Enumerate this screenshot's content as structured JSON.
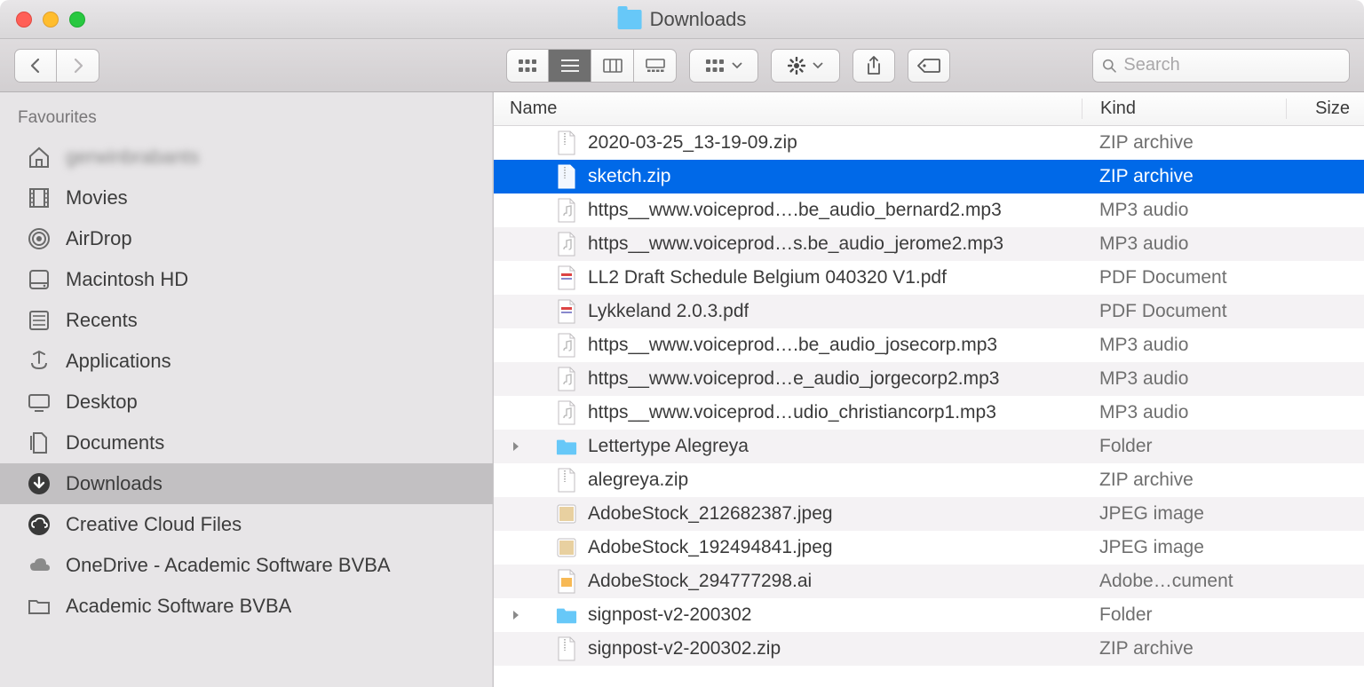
{
  "window": {
    "title": "Downloads"
  },
  "toolbar": {
    "search_placeholder": "Search"
  },
  "sidebar": {
    "header": "Favourites",
    "items": [
      {
        "label": "gerwinbrabants",
        "icon": "home",
        "blurred": true
      },
      {
        "label": "Movies",
        "icon": "film"
      },
      {
        "label": "AirDrop",
        "icon": "airdrop"
      },
      {
        "label": "Macintosh HD",
        "icon": "hdd"
      },
      {
        "label": "Recents",
        "icon": "recents"
      },
      {
        "label": "Applications",
        "icon": "apps"
      },
      {
        "label": "Desktop",
        "icon": "desktop"
      },
      {
        "label": "Documents",
        "icon": "docs"
      },
      {
        "label": "Downloads",
        "icon": "downloads",
        "selected": true
      },
      {
        "label": "Creative Cloud Files",
        "icon": "cc"
      },
      {
        "label": "OneDrive - Academic Software BVBA",
        "icon": "cloud"
      },
      {
        "label": "Academic Software BVBA",
        "icon": "folder"
      }
    ]
  },
  "columns": {
    "name": "Name",
    "kind": "Kind",
    "size": "Size"
  },
  "files": [
    {
      "name": "2020-03-25_13-19-09.zip",
      "kind": "ZIP archive",
      "icon": "zip"
    },
    {
      "name": "sketch.zip",
      "kind": "ZIP archive",
      "icon": "zip",
      "selected": true
    },
    {
      "name": "https__www.voiceprod….be_audio_bernard2.mp3",
      "kind": "MP3 audio",
      "icon": "audio"
    },
    {
      "name": "https__www.voiceprod…s.be_audio_jerome2.mp3",
      "kind": "MP3 audio",
      "icon": "audio"
    },
    {
      "name": "LL2 Draft Schedule Belgium 040320 V1.pdf",
      "kind": "PDF Document",
      "icon": "pdf"
    },
    {
      "name": "Lykkeland 2.0.3.pdf",
      "kind": "PDF Document",
      "icon": "pdf"
    },
    {
      "name": "https__www.voiceprod….be_audio_josecorp.mp3",
      "kind": "MP3 audio",
      "icon": "audio"
    },
    {
      "name": "https__www.voiceprod…e_audio_jorgecorp2.mp3",
      "kind": "MP3 audio",
      "icon": "audio"
    },
    {
      "name": "https__www.voiceprod…udio_christiancorp1.mp3",
      "kind": "MP3 audio",
      "icon": "audio"
    },
    {
      "name": "Lettertype Alegreya",
      "kind": "Folder",
      "icon": "folder",
      "expandable": true
    },
    {
      "name": "alegreya.zip",
      "kind": "ZIP archive",
      "icon": "zip"
    },
    {
      "name": "AdobeStock_212682387.jpeg",
      "kind": "JPEG image",
      "icon": "jpeg"
    },
    {
      "name": "AdobeStock_192494841.jpeg",
      "kind": "JPEG image",
      "icon": "jpeg"
    },
    {
      "name": "AdobeStock_294777298.ai",
      "kind": "Adobe…cument",
      "icon": "ai"
    },
    {
      "name": "signpost-v2-200302",
      "kind": "Folder",
      "icon": "folder",
      "expandable": true
    },
    {
      "name": "signpost-v2-200302.zip",
      "kind": "ZIP archive",
      "icon": "zip"
    }
  ]
}
